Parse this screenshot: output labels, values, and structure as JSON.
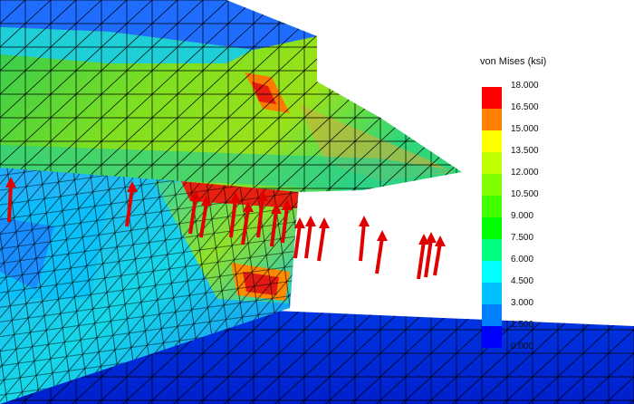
{
  "legend": {
    "title": "von Mises (ksi)",
    "labels": [
      "18.000",
      "16.500",
      "15.000",
      "13.500",
      "12.000",
      "10.500",
      "9.000",
      "7.500",
      "6.000",
      "4.500",
      "3.000",
      "1.500",
      "0.000"
    ],
    "colors": [
      "#ff0000",
      "#ff8000",
      "#ffff00",
      "#c0ff00",
      "#80ff00",
      "#40ff00",
      "#00ff00",
      "#00ff80",
      "#00ffff",
      "#00c0ff",
      "#0080ff",
      "#0000ff"
    ]
  },
  "model": {
    "mesh_color": "#000000",
    "load_arrow_color": "#e00000"
  }
}
